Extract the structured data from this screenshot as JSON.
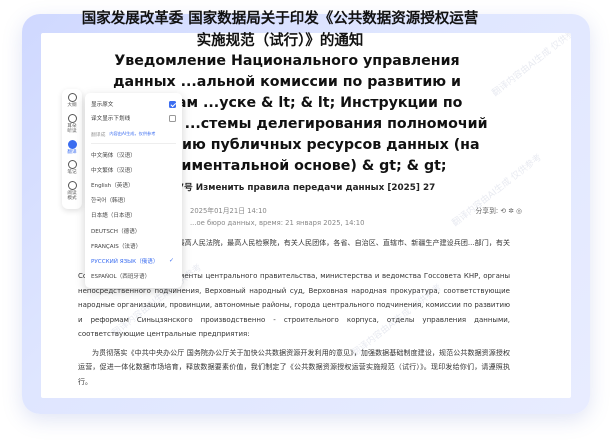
{
  "document": {
    "title_zh": "国家发展改革委 国家数据局关于印发《公共数据资源授权运营实施规范（试行）》的通知",
    "title_ru": "Уведомление Национального управления данных ...альной комиссии по развитию и реформам ...уске & lt; & lt; Инструкции по внедрению ...стемы делегирования полномочий на ...уатацию публичных ресурсов данных (на ...спериментальной основе) & gt; & gt;",
    "doc_number": "...据规〔2025〕27号 Изменить правила передачи данных [2025] 27",
    "meta_line1": "2025年01月21日 14:10",
    "meta_line2": "...ое бюро данных, время: 21 января 2025, 14:10",
    "share_label": "分享到:",
    "share_icons": "⟲ ✲ ◎",
    "para1_zh": "...各部委、各直属机构，最高人民法院，最高人民检察院，有关人民团体，各省、自治区、直辖市、新疆生产建设兵团...部门，有关中央企业:",
    "para1_ru": "Соответствующие департаменты центрального правительства, министерства и ведомства Госсовета КНР, органы непосредственного подчинения, Верховный народный суд, Верховная народная прокуратура, соответствующие народные организации, провинции, автономные районы, города центрального подчинения, комиссии по развитию и реформам Синьцзянского производственно - строительного корпуса, отделы управления данными, соответствующие центральные предприятия:",
    "para2_zh": "为贯彻落实《中共中央办公厅 国务院办公厅关于加快公共数据资源开发利用的意见》，加强数据基础制度建设，规范公共数据资源授权运营，促进一体化数据市场培育，释放数据要素价值，我们制定了《公共数据资源授权运营实施规范（试行）》。现印发给你们，请遵照执行。",
    "watermark": "翻译内容由AI生成 仅供参考"
  },
  "toolbar": {
    "items": [
      {
        "label": "大纲",
        "icon": "outline-icon"
      },
      {
        "label": "耳朵\n听读",
        "icon": "headphone-icon"
      },
      {
        "label": "翻译",
        "icon": "translate-icon"
      },
      {
        "label": "笔记",
        "icon": "note-icon"
      },
      {
        "label": "阅读\n模式",
        "icon": "read-mode-icon"
      }
    ]
  },
  "panel": {
    "show_original": "显示原文",
    "show_original_checked": true,
    "underline_translation": "译文显示下划线",
    "underline_checked": false,
    "translate_label": "翻译成",
    "translate_note": "内容由AI生成，仅供参考",
    "languages": [
      "中文简体（汉语）",
      "中文繁体（汉语）",
      "English（英语）",
      "한국어（韩语）",
      "日本語（日本语）",
      "DEUTSCH（德语）",
      "FRANÇAIS（法语）",
      "РУССКИЙ ЯЗЫК（俄语）",
      "ESPAÑOL（西班牙语）"
    ],
    "selected_language": "РУССКИЙ ЯЗЫК（俄语）",
    "accent_color": "#3b6df0"
  }
}
